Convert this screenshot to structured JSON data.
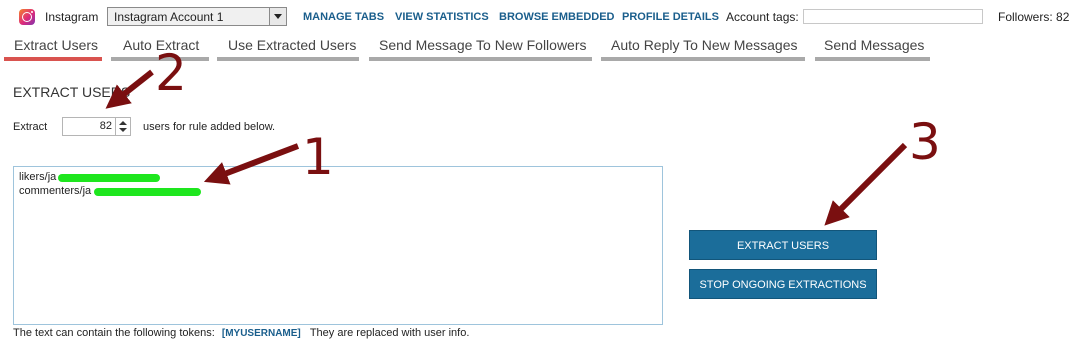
{
  "topbar": {
    "app_label": "Instagram",
    "account_select": "Instagram Account 1",
    "links": [
      "MANAGE TABS",
      "VIEW STATISTICS",
      "BROWSE EMBEDDED",
      "PROFILE DETAILS"
    ],
    "account_tags_label": "Account tags:",
    "account_tags_value": "",
    "followers": "Followers: 82"
  },
  "tabs": [
    {
      "label": "Extract Users",
      "active": true
    },
    {
      "label": "Auto Extract",
      "active": false
    },
    {
      "label": "Use Extracted Users",
      "active": false
    },
    {
      "label": "Send Message To New Followers",
      "active": false
    },
    {
      "label": "Auto Reply To New Messages",
      "active": false
    },
    {
      "label": "Send Messages",
      "active": false
    }
  ],
  "section": {
    "title": "EXTRACT USERS",
    "extract_label": "Extract",
    "extract_count": "82",
    "extract_suffix": "users for rule added below.",
    "rules": [
      "likers/ja",
      "commenters/ja"
    ],
    "tokens_prefix": "The text can contain the following tokens:",
    "token": "[MYUSERNAME]",
    "tokens_suffix": "They are replaced with user info."
  },
  "buttons": {
    "extract": "EXTRACT USERS",
    "stop": "STOP ONGOING EXTRACTIONS"
  },
  "annotations": [
    "1",
    "2",
    "3"
  ],
  "colors": {
    "accent": "#1b6d9a",
    "active_tab": "#d9534f",
    "annotation": "#7a0f10",
    "redaction": "#1ee61e"
  },
  "icons": {
    "app": "instagram-icon"
  }
}
